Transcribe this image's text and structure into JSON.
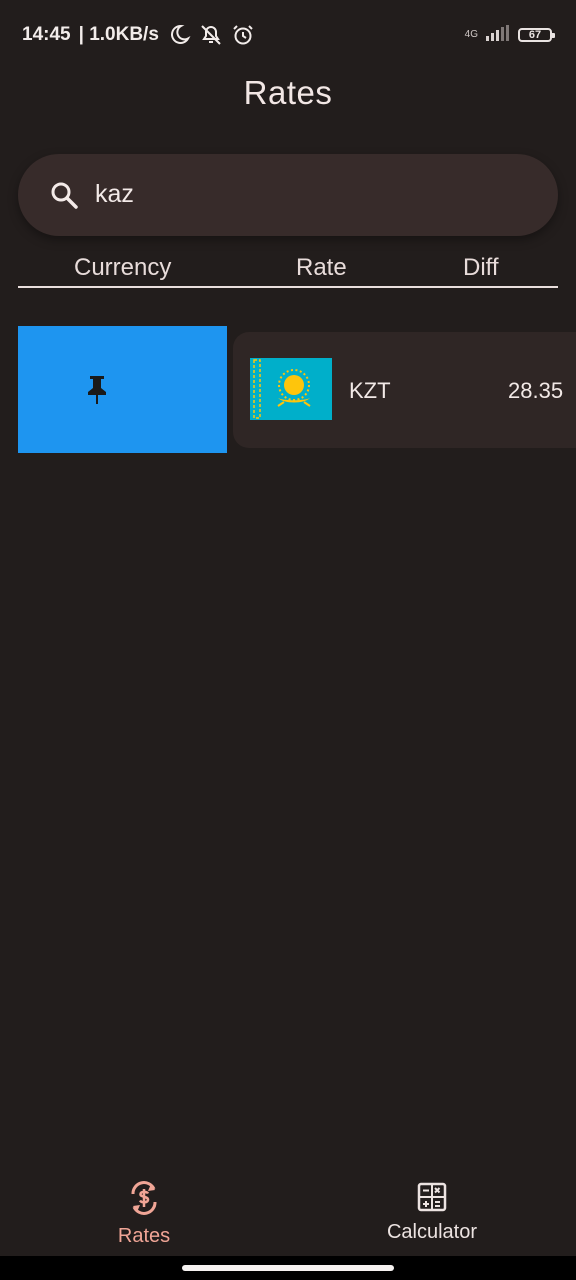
{
  "status_bar": {
    "time": "14:45",
    "speed": "| 1.0KB/s",
    "network": "4G",
    "battery": "67"
  },
  "header": {
    "title": "Rates"
  },
  "search": {
    "value": "kaz"
  },
  "table": {
    "columns": [
      "Currency",
      "Rate",
      "Diff"
    ],
    "rows": [
      {
        "code": "KZT",
        "rate": "28.35",
        "flag_icon": "kazakhstan-flag-icon",
        "action_icon": "pin-icon"
      }
    ]
  },
  "colors": {
    "background": "#221d1c",
    "search_background": "#372b2a",
    "card_background": "#2f2625",
    "pin_action": "#1e95f0",
    "active_nav": "#f0a596",
    "flag_blue": "#00afca",
    "flag_yellow": "#fec50c"
  },
  "bottom_nav": {
    "items": [
      {
        "label": "Rates",
        "icon": "currency-exchange-icon",
        "active": true
      },
      {
        "label": "Calculator",
        "icon": "calculator-icon",
        "active": false
      }
    ]
  }
}
